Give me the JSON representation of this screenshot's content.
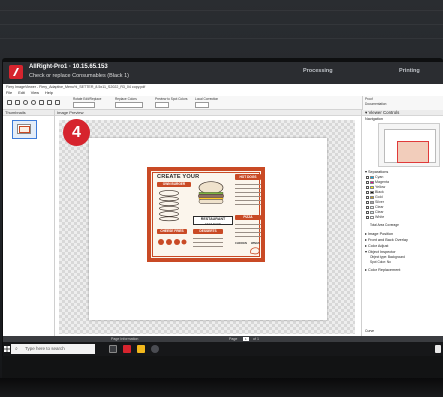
{
  "titlebar": {
    "app_name": "AllRight-Pro1",
    "version_ip": "10.15.65.153",
    "subtitle": "Check or replace Consumables (Black 1)",
    "stat_processing": "Processing",
    "stat_printing": "Printing"
  },
  "path": "Fiery ImageViewer - Fiery_Adaptive_Menu%_SETTER_8.5x11_S2022_R3_04 copy.pdf",
  "menu": [
    "File",
    "Edit",
    "View",
    "Help"
  ],
  "toolbar": {
    "group1": "Rotate Edit/Replace",
    "group2": "Replace Colors",
    "group3": "Preview to Spot Colors",
    "group4": "Local Correction"
  },
  "panels": {
    "thumbnails": "Thumbnails",
    "preview": "Image Preview",
    "viewer_controls": "Viewer Controls",
    "navigation": "Navigation"
  },
  "right_top": {
    "label1": "Proof",
    "label2": "Documentation"
  },
  "step_badge": "4",
  "artwork": {
    "title": "CREATE YOUR",
    "title_tag": "OWN BURGER",
    "hotdogs": "HOT DOGS",
    "pizza": "PIZZA",
    "restaurant": "RESTAURANT",
    "fast_food": "FAST FOOD",
    "cheese_fries": "CHEESE FRIES",
    "desserts": "DESSERTS",
    "chicken": "CHICKEN",
    "wings": "WINGS"
  },
  "separations": {
    "title": "Separations",
    "items": [
      {
        "label": "Cyan",
        "color": "#00aeef"
      },
      {
        "label": "Magenta",
        "color": "#ec008c"
      },
      {
        "label": "Yellow",
        "color": "#fff200"
      },
      {
        "label": "Black",
        "color": "#111111"
      },
      {
        "label": "Gold",
        "color": "#c9a227"
      },
      {
        "label": "Silver",
        "color": "#a7a9ac"
      },
      {
        "label": "Clear",
        "color": "#e8f3f5"
      },
      {
        "label": "Clear",
        "color": "#d7eaee"
      },
      {
        "label": "White",
        "color": "#ffffff"
      }
    ],
    "total_area": "Total Area Coverage"
  },
  "sections": [
    "Image Position",
    "Front and Back Overlay",
    "Color Adjust",
    "Object Inspector",
    "Color Replacement"
  ],
  "object_inspector": {
    "object_type": "Object type: Background",
    "spot_color": "Spot Color: No"
  },
  "right_bottom": "Curve",
  "statusbar": {
    "page_info": "Page Information",
    "page_label": "Page",
    "page_value": "1",
    "of": "of 1"
  },
  "taskbar": {
    "search_placeholder": "Type here to search"
  }
}
